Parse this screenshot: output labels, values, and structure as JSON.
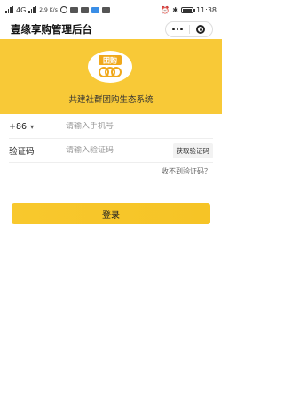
{
  "status_bar": {
    "network": "4G",
    "speed": "2.9 K/s",
    "time": "11:38"
  },
  "header": {
    "title": "壹缘享购管理后台"
  },
  "hero": {
    "logo_text": "团购",
    "slogan": "共建社群团购生态系统"
  },
  "form": {
    "country_code": "+86",
    "phone_placeholder": "请输入手机号",
    "phone_value": "",
    "code_label": "验证码",
    "code_placeholder": "请输入验证码",
    "code_value": "",
    "get_code_label": "获取验证码",
    "no_receive_label": "收不到验证码？"
  },
  "login_label": "登录",
  "colors": {
    "brand_yellow": "#f8c937",
    "button_yellow": "#f8c82d"
  }
}
